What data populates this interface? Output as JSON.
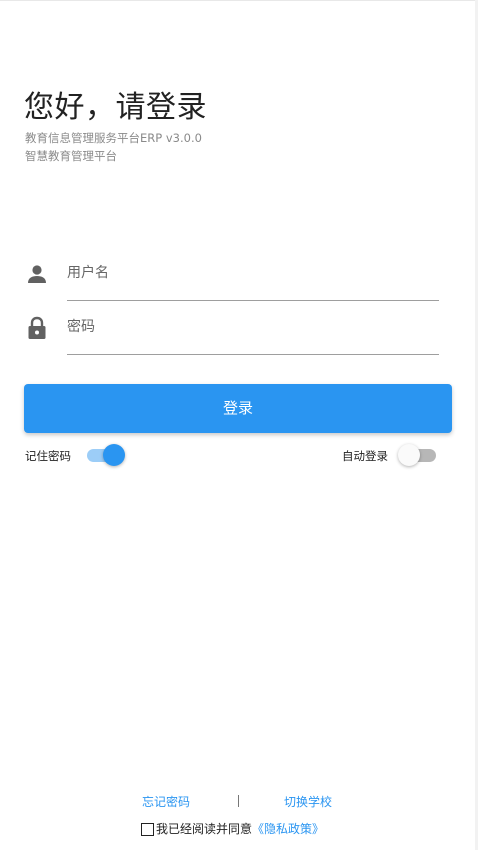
{
  "header": {
    "title": "您好，请登录",
    "subtitle_line1": "教育信息管理服务平台ERP v3.0.0",
    "subtitle_line2": "智慧教育管理平台"
  },
  "form": {
    "username_placeholder": "用户名",
    "username_icon": "person-icon",
    "password_placeholder": "密码",
    "password_icon": "lock-icon",
    "login_label": "登录"
  },
  "options": {
    "remember_label": "记住密码",
    "remember_on": true,
    "autologin_label": "自动登录",
    "autologin_on": false
  },
  "footer": {
    "forgot_label": "忘记密码",
    "separator": "|",
    "switch_school_label": "切换学校",
    "agree_text": "我已经阅读并同意",
    "policy_label": "《隐私政策》"
  },
  "colors": {
    "accent": "#2a95f1",
    "accent_light": "#9ccdf7",
    "switch_off_track": "#b7b7b7",
    "text_muted": "#8a8a8a",
    "icon_gray": "#616161"
  }
}
